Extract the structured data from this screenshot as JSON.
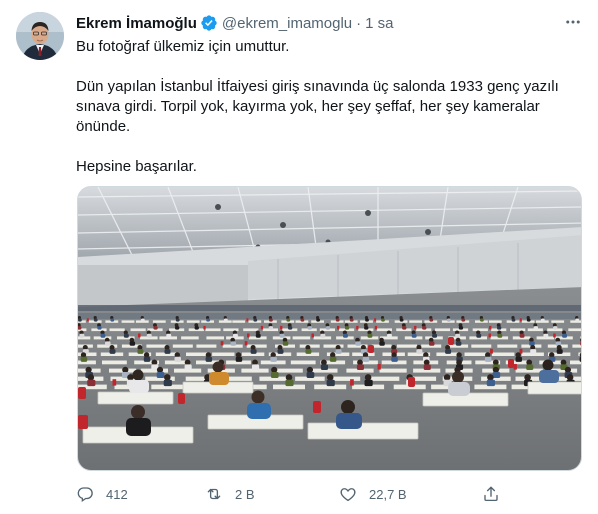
{
  "tweet": {
    "author": {
      "name": "Ekrem İmamoğlu",
      "handle": "@ekrem_imamoglu",
      "separator": "·",
      "time": "1 sa",
      "verified": true
    },
    "paragraphs": [
      "Bu fotoğraf ülkemiz için umuttur.",
      "Dün yapılan İstanbul İtfaiyesi giriş sınavında üç salonda 1933 genç yazılı sınava girdi. Torpil yok, kayırma yok, her şey şeffaf, her şey kameralar önünde.",
      "Hepsine başarılar."
    ],
    "actions": {
      "reply_count": "412",
      "retweet_count": "2 B",
      "like_count": "22,7 B"
    }
  },
  "icons": {
    "verified": "verified-badge-icon",
    "more": "more-dots-icon",
    "reply": "reply-icon",
    "retweet": "retweet-icon",
    "like": "heart-icon",
    "share": "share-icon"
  },
  "colors": {
    "verified_blue": "#1d9bf0",
    "secondary_text": "#536471",
    "primary_text": "#0f1419"
  }
}
